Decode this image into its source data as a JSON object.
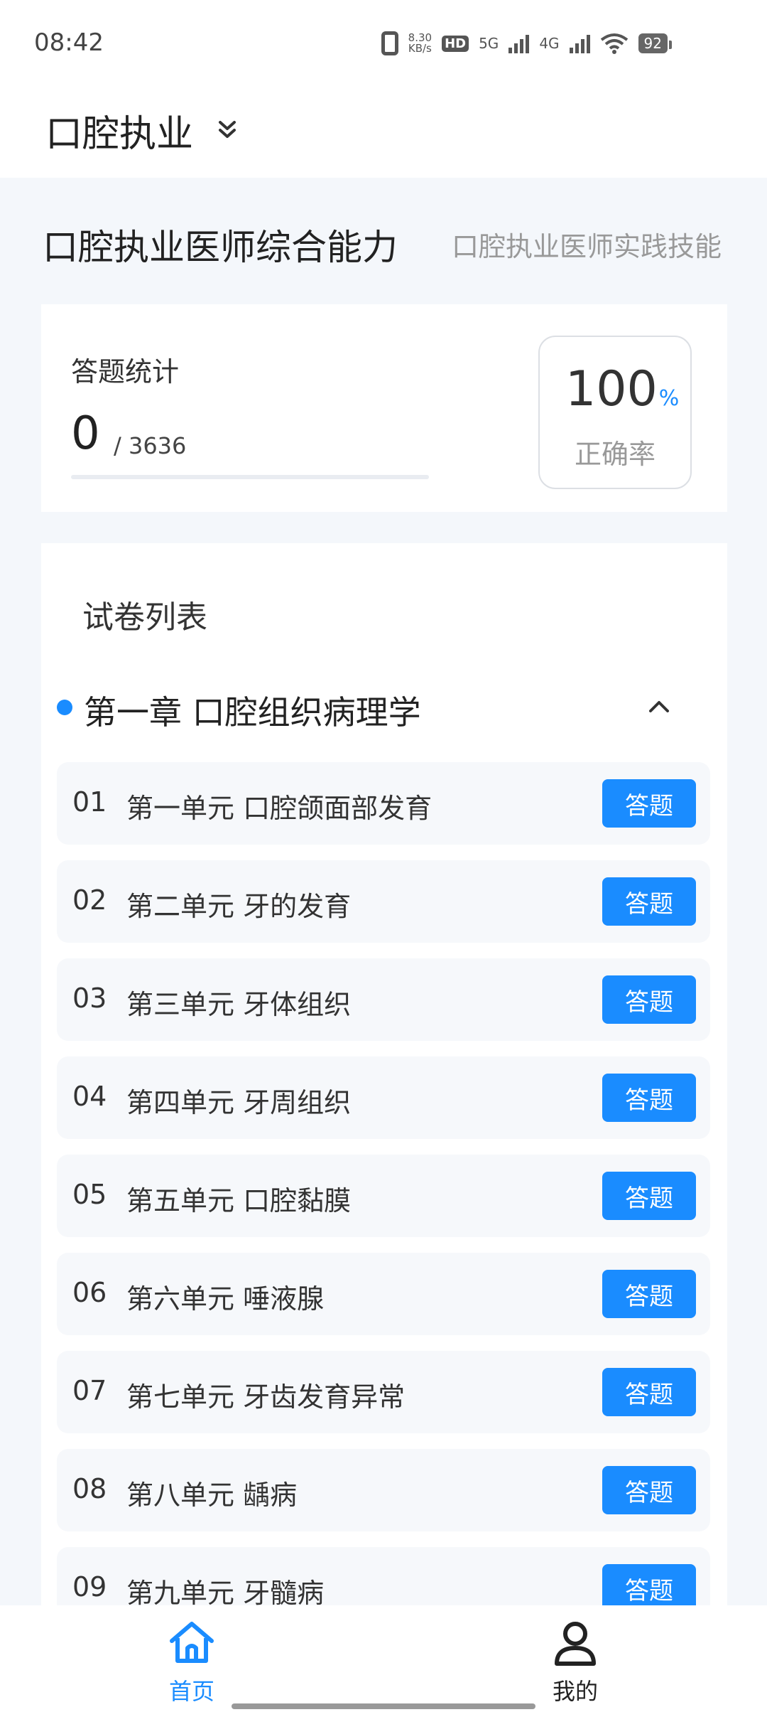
{
  "status_bar": {
    "time": "08:42",
    "net_speed_value": "8.30",
    "net_speed_unit": "KB/s",
    "hd": "HD",
    "sim1_label": "5G",
    "sim2_label": "4G",
    "battery": "92"
  },
  "header": {
    "title": "口腔执业",
    "dropdown_icon": "double-chevron-down-icon"
  },
  "subject_tabs": [
    {
      "label": "口腔执业医师综合能力",
      "active": true
    },
    {
      "label": "口腔执业医师实践技能",
      "active": false
    }
  ],
  "stats": {
    "title": "答题统计",
    "answered": "0",
    "total": "/ 3636",
    "progress": 0,
    "accuracy_value": "100",
    "accuracy_unit": "%",
    "accuracy_label": "正确率"
  },
  "paper_list": {
    "title": "试卷列表",
    "chapter": {
      "title": "第一章 口腔组织病理学",
      "expanded": true
    },
    "units": [
      {
        "num": "01",
        "name": "第一单元 口腔颌面部发育",
        "action": "答题"
      },
      {
        "num": "02",
        "name": "第二单元 牙的发育",
        "action": "答题"
      },
      {
        "num": "03",
        "name": "第三单元 牙体组织",
        "action": "答题"
      },
      {
        "num": "04",
        "name": "第四单元 牙周组织",
        "action": "答题"
      },
      {
        "num": "05",
        "name": "第五单元 口腔黏膜",
        "action": "答题"
      },
      {
        "num": "06",
        "name": "第六单元 唾液腺",
        "action": "答题"
      },
      {
        "num": "07",
        "name": "第七单元 牙齿发育异常",
        "action": "答题"
      },
      {
        "num": "08",
        "name": "第八单元 龋病",
        "action": "答题"
      },
      {
        "num": "09",
        "name": "第九单元 牙髓病",
        "action": "答题"
      }
    ]
  },
  "bottom_nav": {
    "home_label": "首页",
    "mine_label": "我的"
  },
  "colors": {
    "accent": "#1a8cff",
    "background": "#f4f7fb",
    "card": "#ffffff"
  }
}
